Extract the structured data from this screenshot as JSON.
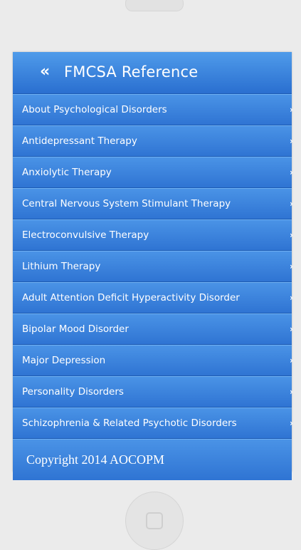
{
  "header": {
    "back_icon": "double-chevron-left-icon",
    "back_glyph": "«",
    "title": "FMCSA Reference"
  },
  "menu": {
    "chevron_icon": "chevron-right-icon",
    "chevron_glyph": "›",
    "items": [
      {
        "label": "About Psychological Disorders"
      },
      {
        "label": "Antidepressant Therapy"
      },
      {
        "label": "Anxiolytic Therapy"
      },
      {
        "label": "Central Nervous System Stimulant Therapy"
      },
      {
        "label": "Electroconvulsive Therapy"
      },
      {
        "label": "Lithium Therapy"
      },
      {
        "label": "Adult Attention Deficit Hyperactivity Disorder"
      },
      {
        "label": "Bipolar Mood Disorder"
      },
      {
        "label": "Major Depression"
      },
      {
        "label": "Personality Disorders"
      },
      {
        "label": "Schizophrenia & Related Psychotic Disorders"
      }
    ]
  },
  "footer": {
    "text": "Copyright 2014 AOCOPM"
  },
  "colors": {
    "header_top": "#4f9bea",
    "header_bottom": "#2a6fd0",
    "item_top": "#4a93e6",
    "item_bottom": "#2f74d3",
    "background": "#ebebeb"
  }
}
